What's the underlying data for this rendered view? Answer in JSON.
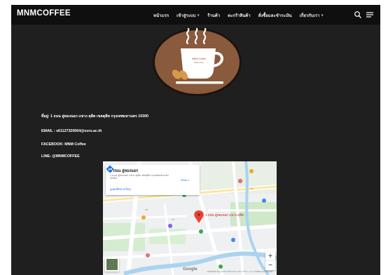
{
  "brand": "MNMCOFFEE",
  "nav": [
    {
      "label": "หน้าแรก",
      "dropdown": false
    },
    {
      "label": "เข้าสู่ระบบ",
      "dropdown": true
    },
    {
      "label": "ร้านค้า",
      "dropdown": false
    },
    {
      "label": "ตะกร้าสินค้า",
      "dropdown": false
    },
    {
      "label": "สั่งซื้อและชำระเงิน",
      "dropdown": false
    },
    {
      "label": "เกี่ยวกับเรา",
      "dropdown": true
    }
  ],
  "icons": {
    "chevron": "chevron-down-icon",
    "search": "search-icon",
    "menu": "hamburger-menu-icon"
  },
  "logo": {
    "text_line1": "MNM Coffee",
    "text_line2": "Café more",
    "colors": {
      "ring": "#1b1410",
      "fill": "#8a5a3c",
      "steam": "#ffffff"
    }
  },
  "info": {
    "address": "ที่อยู่: 1 ถนน อู่ทองนอก แขวง ดุสิต เขตดุสิต กรุงเทพมหานคร 10300",
    "email": "EMAIL : s61127320064@ssru.ac.th",
    "facebook": "FACEBOOK: MNM Coffee",
    "line": "LINE: @MNMCOFFEE"
  },
  "map": {
    "card_title": "1 ถนน อู่ทองนอก",
    "card_address": "1 ถนน อู่ทองนอก แขวง ดุสิต เขตดุสิต กรุงเทพมหานคร 10300",
    "card_link": "ดูแผนที่ขนาดใหญ่",
    "directions_label": "เส้นทาง",
    "pin_label": "1 ถนน อู่ทองนอก แขวง ดุสิต",
    "google": "Google",
    "footer": "แป้นพิมพ์ลัด  ข้อมูลแผนที่ ©2022  ข้อกำหนดการใช้งาน  รายงานข้อผิดพลาดของแผนที่",
    "zoom_in": "+",
    "zoom_out": "−"
  }
}
